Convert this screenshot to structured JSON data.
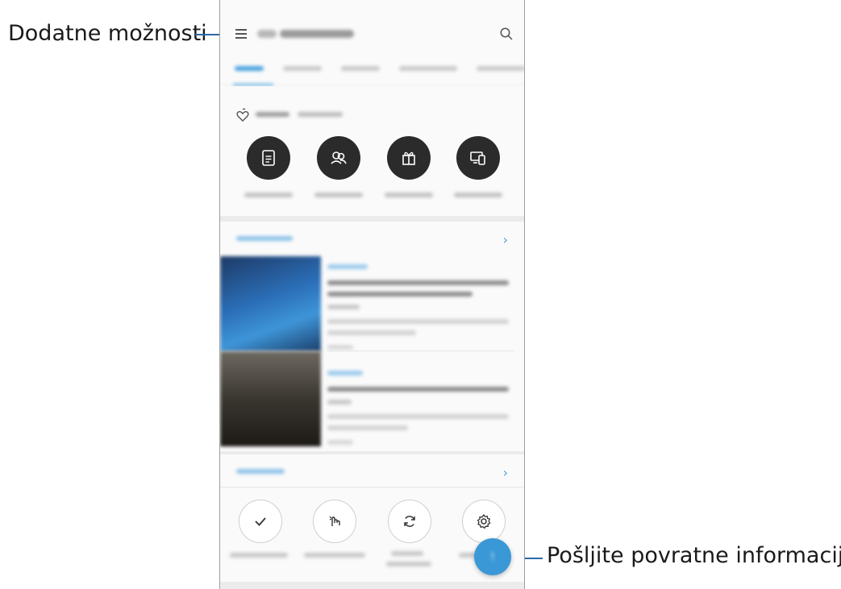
{
  "annotations": {
    "left_label": "Dodatne možnosti",
    "right_label": "Pošljite povratne informacije."
  },
  "app": {
    "menu_icon": "hamburger-menu-icon",
    "search_icon": "search-icon"
  },
  "quick_actions": {
    "icons": [
      "document-icon",
      "people-icon",
      "gift-icon",
      "devices-icon"
    ]
  },
  "tools": {
    "icons": [
      "checkmark-icon",
      "touch-gesture-icon",
      "refresh-icon",
      "settings-icon"
    ]
  },
  "fab": {
    "icon": "feedback-icon"
  },
  "colors": {
    "accent": "#3a98d6",
    "leader_line": "#2a6aa8",
    "dark_button": "#2b2b2b"
  }
}
